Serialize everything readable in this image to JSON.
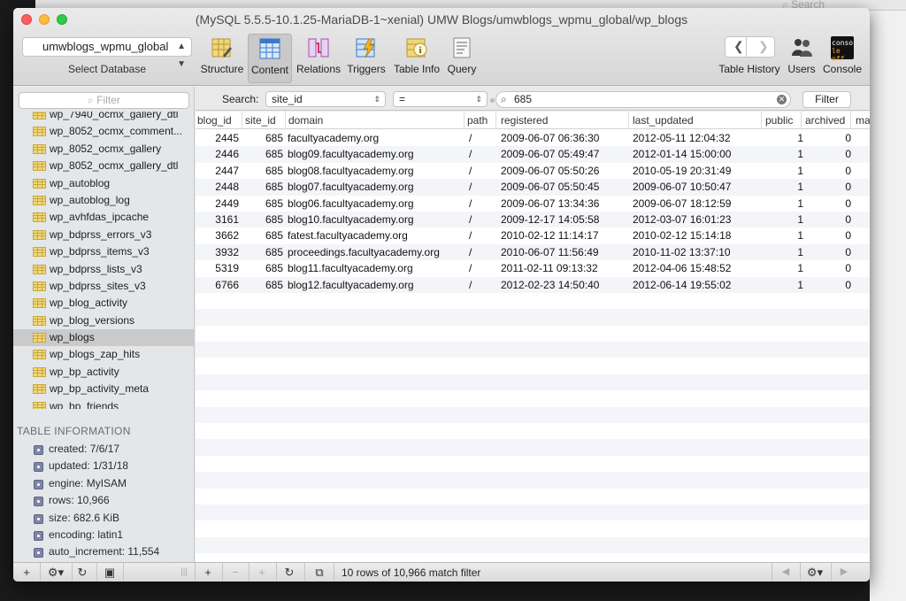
{
  "background_window": {
    "search_placeholder": "Search"
  },
  "window": {
    "title": "(MySQL 5.5.5-10.1.25-MariaDB-1~xenial) UMW Blogs/umwblogs_wpmu_global/wp_blogs"
  },
  "database": {
    "selected": "umwblogs_wpmu_global",
    "caption": "Select Database"
  },
  "toolbar": {
    "items": [
      {
        "label": "Structure",
        "icon": "structure-icon"
      },
      {
        "label": "Content",
        "icon": "content-icon",
        "active": true
      },
      {
        "label": "Relations",
        "icon": "relations-icon"
      },
      {
        "label": "Triggers",
        "icon": "triggers-icon"
      },
      {
        "label": "Table Info",
        "icon": "table-info-icon"
      },
      {
        "label": "Query",
        "icon": "query-icon"
      }
    ],
    "right": [
      {
        "label": "Table History",
        "icon": "history-icon"
      },
      {
        "label": "Users",
        "icon": "users-icon"
      },
      {
        "label": "Console",
        "icon": "console-icon",
        "console_text_top": "conso",
        "console_text_bottom": "le off"
      }
    ]
  },
  "sidebar": {
    "filter_placeholder": "Filter",
    "tables": [
      "wp_7940_ocmx_gallery_dtl",
      "wp_8052_ocmx_comment...",
      "wp_8052_ocmx_gallery",
      "wp_8052_ocmx_gallery_dtl",
      "wp_autoblog",
      "wp_autoblog_log",
      "wp_avhfdas_ipcache",
      "wp_bdprss_errors_v3",
      "wp_bdprss_items_v3",
      "wp_bdprss_lists_v3",
      "wp_bdprss_sites_v3",
      "wp_blog_activity",
      "wp_blog_versions",
      "wp_blogs",
      "wp_blogs_zap_hits",
      "wp_bp_activity",
      "wp_bp_activity_meta",
      "wp_bp_friends"
    ],
    "selected_table": "wp_blogs",
    "info_header": "TABLE INFORMATION",
    "info": [
      "created: 7/6/17",
      "updated: 1/31/18",
      "engine: MyISAM",
      "rows: 10,966",
      "size: 682.6 KiB",
      "encoding: latin1",
      "auto_increment: 11,554"
    ]
  },
  "search": {
    "label": "Search:",
    "field": "site_id",
    "operator": "=",
    "value": "685",
    "filter_button": "Filter"
  },
  "grid": {
    "columns": [
      "blog_id",
      "site_id",
      "domain",
      "path",
      "registered",
      "last_updated",
      "public",
      "archived",
      "ma"
    ],
    "rows": [
      [
        "2445",
        "685",
        "facultyacademy.org",
        "/",
        "2009-06-07 06:36:30",
        "2012-05-11 12:04:32",
        "1",
        "0"
      ],
      [
        "2446",
        "685",
        "blog09.facultyacademy.org",
        "/",
        "2009-06-07 05:49:47",
        "2012-01-14 15:00:00",
        "1",
        "0"
      ],
      [
        "2447",
        "685",
        "blog08.facultyacademy.org",
        "/",
        "2009-06-07 05:50:26",
        "2010-05-19 20:31:49",
        "1",
        "0"
      ],
      [
        "2448",
        "685",
        "blog07.facultyacademy.org",
        "/",
        "2009-06-07 05:50:45",
        "2009-06-07 10:50:47",
        "1",
        "0"
      ],
      [
        "2449",
        "685",
        "blog06.facultyacademy.org",
        "/",
        "2009-06-07 13:34:36",
        "2009-06-07 18:12:59",
        "1",
        "0"
      ],
      [
        "3161",
        "685",
        "blog10.facultyacademy.org",
        "/",
        "2009-12-17 14:05:58",
        "2012-03-07 16:01:23",
        "1",
        "0"
      ],
      [
        "3662",
        "685",
        "fatest.facultyacademy.org",
        "/",
        "2010-02-12 11:14:17",
        "2010-02-12 15:14:18",
        "1",
        "0"
      ],
      [
        "3932",
        "685",
        "proceedings.facultyacademy.org",
        "/",
        "2010-06-07 11:56:49",
        "2010-11-02 13:37:10",
        "1",
        "0"
      ],
      [
        "5319",
        "685",
        "blog11.facultyacademy.org",
        "/",
        "2011-02-11 09:13:32",
        "2012-04-06 15:48:52",
        "1",
        "0"
      ],
      [
        "6766",
        "685",
        "blog12.facultyacademy.org",
        "/",
        "2012-02-23 14:50:40",
        "2012-06-14 19:55:02",
        "1",
        "0"
      ]
    ]
  },
  "status": {
    "text": "10 rows of 10,966 match filter"
  },
  "bottom": {
    "add": "+",
    "remove": "−",
    "duplicate": "+",
    "refresh": "↻",
    "settings": "⚙",
    "prev": "◀",
    "next": "▶"
  }
}
